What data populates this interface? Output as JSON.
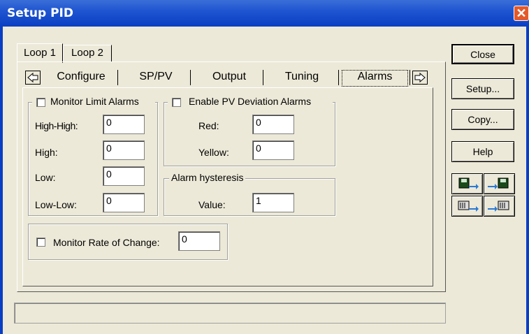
{
  "window": {
    "title": "Setup PID"
  },
  "loop_tabs": [
    "Loop 1",
    "Loop 2"
  ],
  "sub_tabs": [
    "Configure",
    "SP/PV",
    "Output",
    "Tuning",
    "Alarms"
  ],
  "active_sub_tab": "Alarms",
  "monitor_limit": {
    "label": "Monitor Limit Alarms",
    "checked": false,
    "fields": [
      {
        "label": "High-High:",
        "value": "0"
      },
      {
        "label": "High:",
        "value": "0"
      },
      {
        "label": "Low:",
        "value": "0"
      },
      {
        "label": "Low-Low:",
        "value": "0"
      }
    ]
  },
  "pv_deviation": {
    "label": "Enable PV Deviation Alarms",
    "checked": false,
    "fields": [
      {
        "label": "Red:",
        "value": "0"
      },
      {
        "label": "Yellow:",
        "value": "0"
      }
    ]
  },
  "hysteresis": {
    "label": "Alarm hysteresis",
    "value_label": "Value:",
    "value": "1"
  },
  "rate_of_change": {
    "label": "Monitor Rate of Change:",
    "checked": false,
    "value": "0"
  },
  "buttons": {
    "close": "Close",
    "setup": "Setup...",
    "copy": "Copy...",
    "help": "Help"
  },
  "icon_buttons": [
    "save-to-disk-icon",
    "load-from-disk-icon",
    "save-to-device-icon",
    "load-from-device-icon"
  ],
  "status_text": ""
}
